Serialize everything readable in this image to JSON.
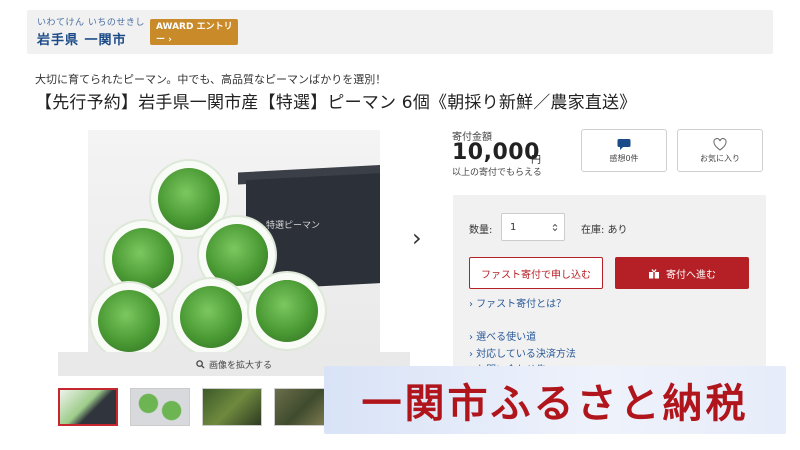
{
  "header": {
    "municipality_kana": "いわてけん いちのせきし",
    "municipality_name": "岩手県 一関市",
    "award_label": "AWARD エントリー ›"
  },
  "product": {
    "subtitle": "大切に育てられたピーマン。中でも、高品質なピーマンばかりを選別！",
    "title": "【先行予約】岩手県一関市産【特選】ピーマン 6個《朝採り新鮮／農家直送》"
  },
  "gallery": {
    "box_label": "特選ピーマン",
    "zoom_label": "画像を拡大する",
    "next_arrow": "›",
    "thumbnail_count": 5
  },
  "donation": {
    "amount_label": "寄付金額",
    "amount": "10,000",
    "amount_unit": "円",
    "amount_note": "以上の寄付でもらえる",
    "impressions_label": "感想0件",
    "favorite_label": "お気に入り"
  },
  "purchase": {
    "qty_label": "数量:",
    "qty_value": "1",
    "stock_label": "在庫: あり",
    "fast_button": "ファスト寄付で申し込む",
    "donate_button": "寄付へ進む",
    "fast_link": "› ファスト寄付とは？",
    "links": [
      "› 選べる使い道",
      "› 対応している決済方法",
      "› お問い合わせ先"
    ]
  },
  "banner": {
    "text": "一関市ふるさと納税"
  },
  "colors": {
    "accent_red": "#b51f26",
    "award_orange": "#c98a2a",
    "link_blue": "#2a5a99"
  }
}
